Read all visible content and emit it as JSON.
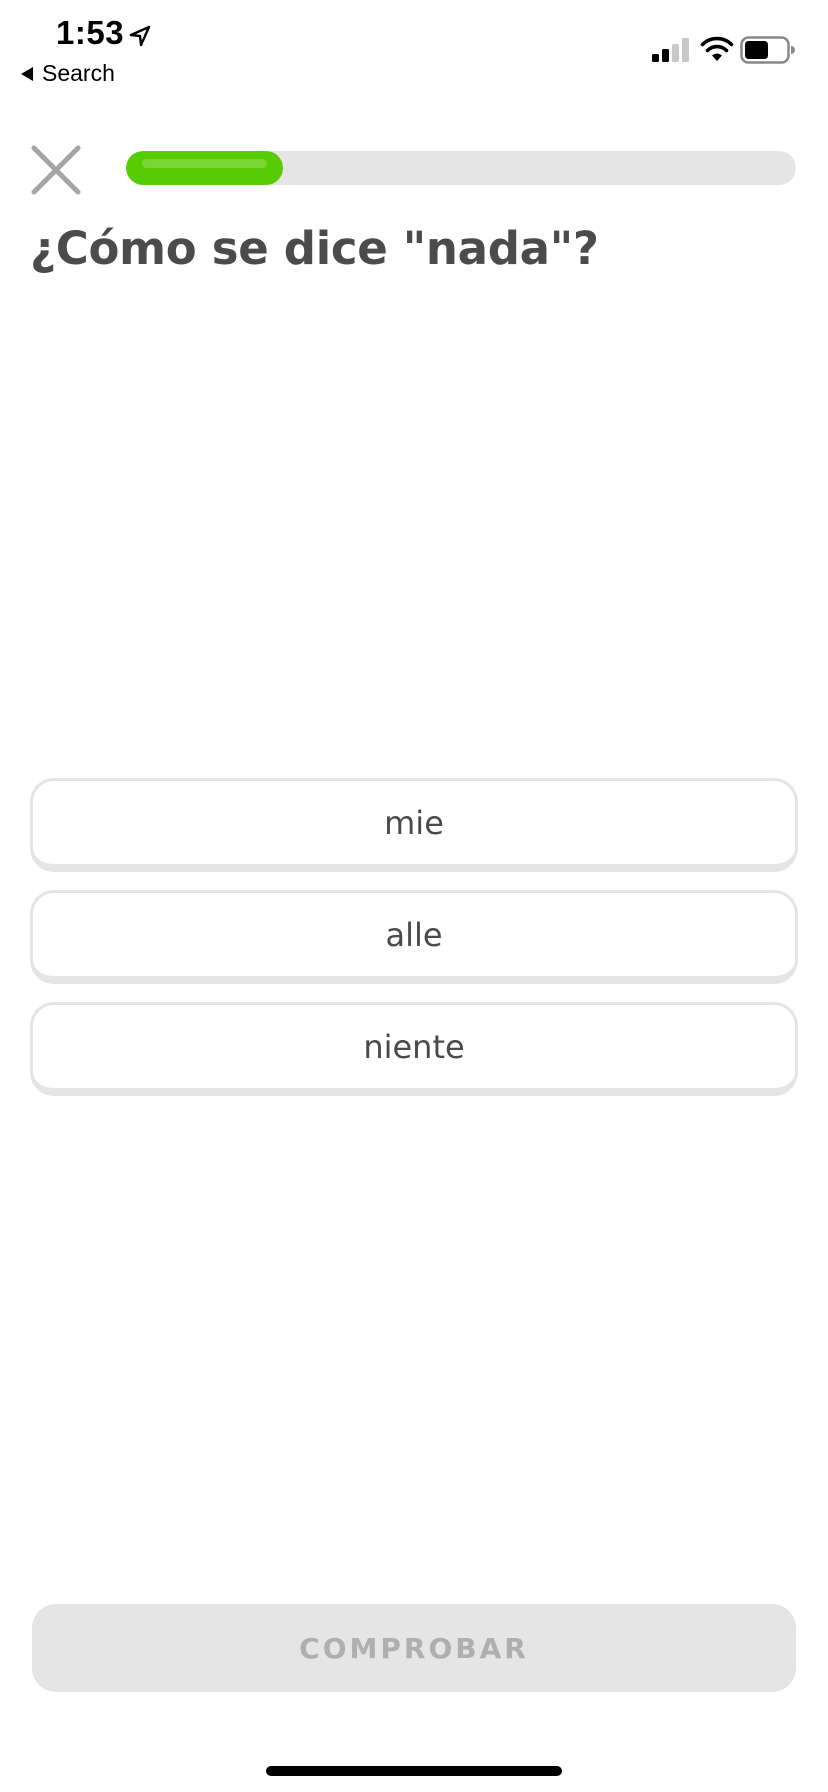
{
  "status_bar": {
    "time": "1:53",
    "back_label": "Search"
  },
  "lesson": {
    "progress": 0.235,
    "question": "¿Cómo se dice \"nada\"?",
    "options": [
      "mie",
      "alle",
      "niente"
    ],
    "check_label": "COMPROBAR"
  },
  "colors": {
    "progress_fill": "#58cc02",
    "progress_track": "#e5e5e5",
    "text": "#4b4b4b",
    "disabled_button": "#e5e5e5",
    "disabled_text": "#afafaf"
  },
  "icons": {
    "close": "close-icon",
    "location": "location-arrow-icon",
    "signal": "signal-icon",
    "wifi": "wifi-icon",
    "battery": "battery-icon"
  }
}
